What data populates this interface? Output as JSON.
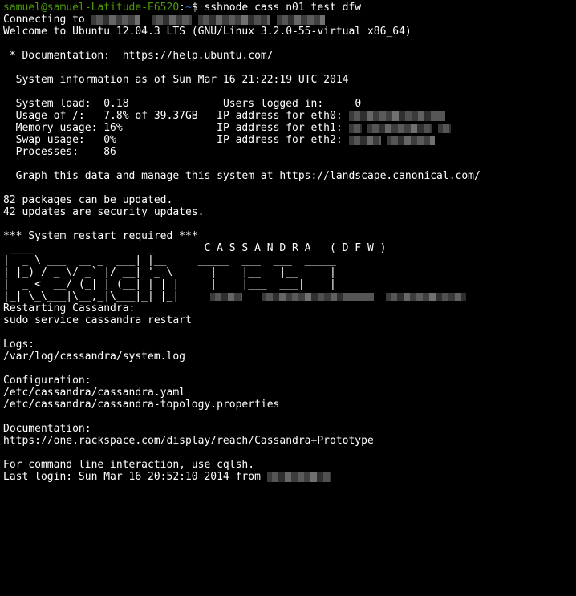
{
  "prompt": {
    "user": "samuel@samuel-Latitude-E6520",
    "sep": ":",
    "path": "~",
    "sigil": "$",
    "cmd": " sshnode cass n01 test dfw"
  },
  "connecting": "Connecting to ",
  "welcome": "Welcome to Ubuntu 12.04.3 LTS (GNU/Linux 3.2.0-55-virtual x86_64)",
  "doc_line": " * Documentation:  https://help.ubuntu.com/",
  "sysinfo_header": "  System information as of Sun Mar 16 21:22:19 UTC 2014",
  "stats": {
    "system_load_label": "  System load:  ",
    "system_load": "0.18",
    "users_label": "Users logged in:     ",
    "users": "0",
    "usage_label": "  Usage of /:   ",
    "usage": "7.8% of 39.37GB",
    "ip0_label": "IP address for eth0: ",
    "mem_label": "  Memory usage: ",
    "mem": "16%",
    "ip1_label": "IP address for eth1: ",
    "swap_label": "  Swap usage:   ",
    "swap": "0%",
    "ip2_label": "IP address for eth2: ",
    "proc_label": "  Processes:    ",
    "proc": "86"
  },
  "graph_line": "  Graph this data and manage this system at https://landscape.canonical.com/",
  "pkg1": "82 packages can be updated.",
  "pkg2": "42 updates are security updates.",
  "restart_req": "*** System restart required ***",
  "ascii": {
    "l1": " ____                  _        C A S S A N D R A   ( D F W )",
    "l2": "|  _ \\ ___  __ _  ___| |__     _____  ___  ___  _____",
    "l3": "| |_) / _ \\/ _` |/ __| '_ \\      |    |__   |__     |",
    "l4": "|  _ <  __/ (_| | (__| | | |     |    |___  ___|    |",
    "l5": "|_| \\_\\___|\\__,_|\\___|_| |_|"
  },
  "restarting": "Restarting Cassandra:",
  "restart_cmd": "sudo service cassandra restart",
  "logs_label": "Logs:",
  "logs_path": "/var/log/cassandra/system.log",
  "conf_label": "Configuration:",
  "conf1": "/etc/cassandra/cassandra.yaml",
  "conf2": "/etc/cassandra/cassandra-topology.properties",
  "docu_label": "Documentation:",
  "docu_url": "https://one.rackspace.com/display/reach/Cassandra+Prototype",
  "cqlsh": "For command line interaction, use cqlsh.",
  "last_login": "Last login: Sun Mar 16 20:52:10 2014 from "
}
